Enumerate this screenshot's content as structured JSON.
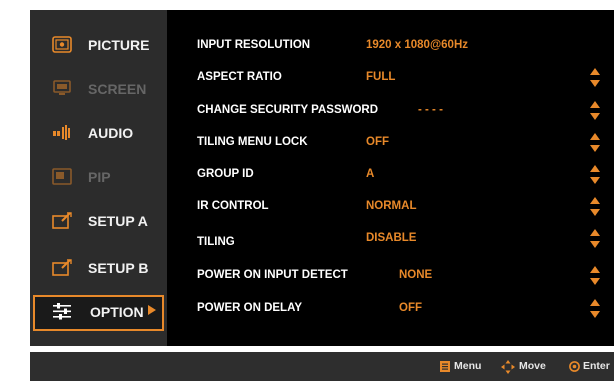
{
  "sidebar": {
    "items": [
      {
        "label": "PICTURE",
        "icon": "picture-icon"
      },
      {
        "label": "SCREEN",
        "icon": "screen-icon"
      },
      {
        "label": "AUDIO",
        "icon": "audio-icon"
      },
      {
        "label": "PIP",
        "icon": "pip-icon"
      },
      {
        "label": "SETUP A",
        "icon": "setup-icon"
      },
      {
        "label": "SETUP B",
        "icon": "setup-icon"
      },
      {
        "label": "OPTION",
        "icon": "option-icon"
      }
    ]
  },
  "settings": {
    "input_resolution": {
      "label": "INPUT RESOLUTION",
      "value": "1920 x 1080@60Hz"
    },
    "aspect_ratio": {
      "label": "ASPECT RATIO",
      "value": "FULL"
    },
    "change_security_password": {
      "label": "CHANGE SECURITY PASSWORD",
      "value": "- - - -"
    },
    "tiling_menu_lock": {
      "label": "TILING MENU LOCK",
      "value": "OFF"
    },
    "group_id": {
      "label": "GROUP ID",
      "value": "A"
    },
    "ir_control": {
      "label": "IR CONTROL",
      "value": "NORMAL"
    },
    "tiling": {
      "label": "TILING",
      "value": "DISABLE"
    },
    "power_on_input_detect": {
      "label": "POWER ON INPUT DETECT",
      "value": "NONE"
    },
    "power_on_delay": {
      "label": "POWER ON DELAY",
      "value": "OFF"
    }
  },
  "footer": {
    "menu_label": "Menu",
    "move_label": "Move",
    "enter_label": "Enter"
  },
  "colors": {
    "accent": "#e8892a",
    "background": "#000000",
    "sidebar": "#2c2c2c"
  }
}
